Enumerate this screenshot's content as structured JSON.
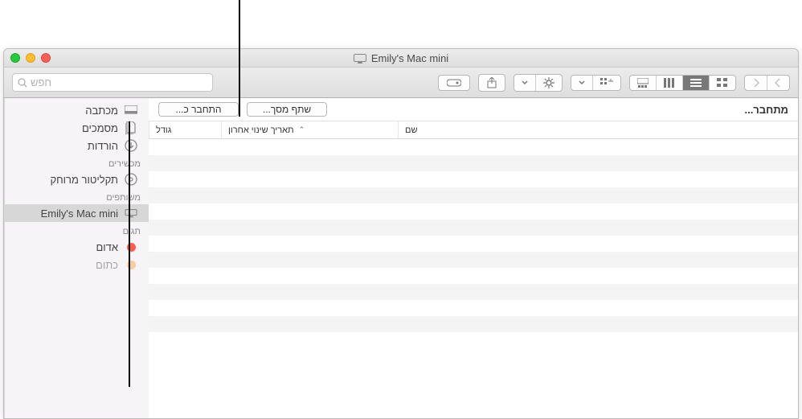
{
  "window": {
    "title": "Emily's Mac mini"
  },
  "toolbar": {
    "search_placeholder": "חפש"
  },
  "sidebar": {
    "favorites": [
      {
        "id": "desktop",
        "label": "מכתבה",
        "icon": "desktop"
      },
      {
        "id": "documents",
        "label": "מסמכים",
        "icon": "documents"
      },
      {
        "id": "downloads",
        "label": "הורדות",
        "icon": "downloads"
      }
    ],
    "devices_heading": "מכשירים",
    "devices": [
      {
        "id": "remote-disc",
        "label": "תקליטור מרוחק",
        "icon": "disc"
      }
    ],
    "shared_heading": "משותפים",
    "shared": [
      {
        "id": "emily-mac-mini",
        "label": "Emily's Mac mini",
        "icon": "computer",
        "selected": true
      }
    ],
    "tags_heading": "תגים",
    "tags": [
      {
        "id": "red",
        "label": "אדום",
        "color": "#ff5b4e"
      },
      {
        "id": "orange",
        "label": "כתום",
        "color": "#ff9d2e"
      }
    ]
  },
  "status": {
    "connecting": "מתחבר...",
    "share_screen": "שתף מסך...",
    "connect_as": "התחבר כ..."
  },
  "columns": {
    "name": "שם",
    "date": "תאריך שינוי אחרון",
    "size": "גודל"
  }
}
